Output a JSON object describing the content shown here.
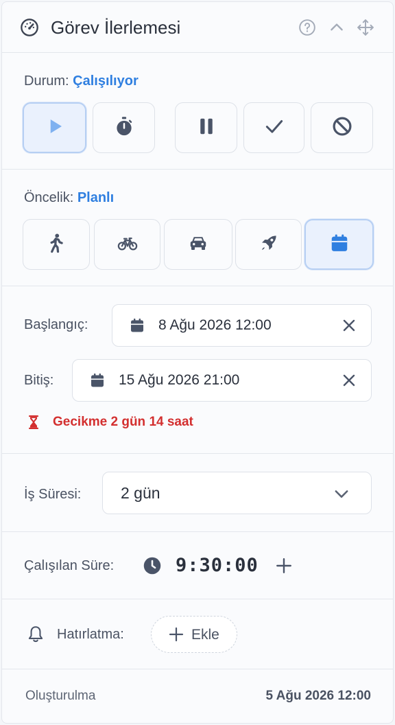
{
  "header": {
    "title": "Görev İlerlemesi",
    "icons": [
      "speedometer-icon",
      "help-icon",
      "chevron-up-icon",
      "move-icon"
    ]
  },
  "status": {
    "label": "Durum:",
    "value": "Çalışılıyor",
    "buttons": [
      {
        "name": "play",
        "icon": "play-icon",
        "active": true
      },
      {
        "name": "stopwatch",
        "icon": "stopwatch-icon",
        "active": false
      },
      {
        "name": "pause",
        "icon": "pause-icon",
        "active": false
      },
      {
        "name": "done",
        "icon": "check-icon",
        "active": false
      },
      {
        "name": "cancel",
        "icon": "ban-icon",
        "active": false
      }
    ]
  },
  "priority": {
    "label": "Öncelik:",
    "value": "Planlı",
    "buttons": [
      {
        "name": "walk",
        "icon": "walking-icon",
        "active": false
      },
      {
        "name": "bike",
        "icon": "bicycle-icon",
        "active": false
      },
      {
        "name": "car",
        "icon": "car-icon",
        "active": false
      },
      {
        "name": "rocket",
        "icon": "rocket-icon",
        "active": false
      },
      {
        "name": "planned",
        "icon": "calendar-icon",
        "active": true
      }
    ]
  },
  "dates": {
    "start_label": "Başlangıç:",
    "start_value": "8 Ağu 2026 12:00",
    "end_label": "Bitiş:",
    "end_value": "15 Ağu 2026 21:00",
    "warning": "Gecikme 2 gün 14 saat"
  },
  "effort": {
    "label": "İş Süresi:",
    "value": "2 gün"
  },
  "worked": {
    "label": "Çalışılan Süre:",
    "time": "9:30:00"
  },
  "reminder": {
    "label": "Hatırlatma:",
    "add_label": "Ekle"
  },
  "footer": {
    "created_label": "Oluşturulma",
    "created_value": "5 Ağu 2026 12:00"
  },
  "colors": {
    "accent": "#2f7fe0",
    "danger": "#d32f2f",
    "icon": "#4a5468"
  }
}
